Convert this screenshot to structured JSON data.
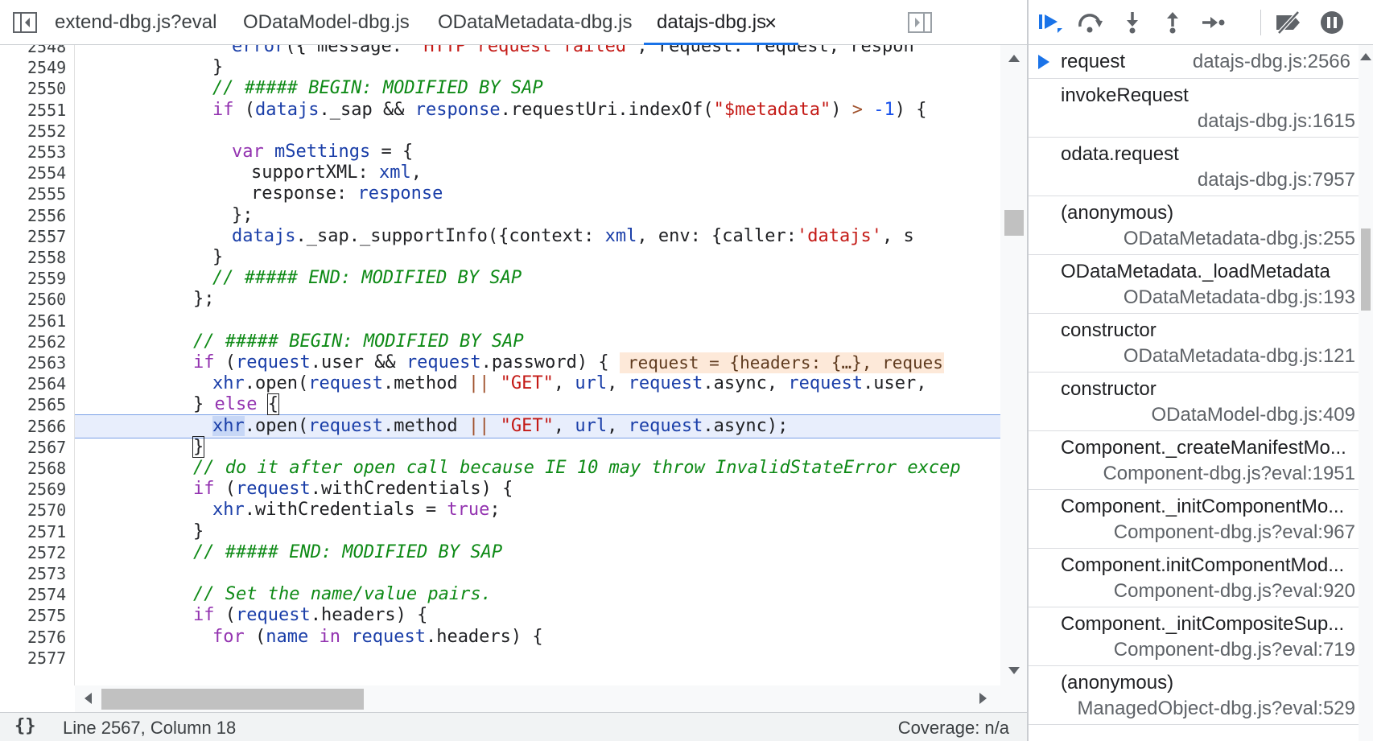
{
  "tabs": [
    {
      "label": "extend-dbg.js?eval",
      "active": false
    },
    {
      "label": "ODataModel-dbg.js",
      "active": false
    },
    {
      "label": "ODataMetadata-dbg.js",
      "active": false
    },
    {
      "label": "datajs-dbg.js",
      "active": true
    }
  ],
  "tab_close_glyph": "×",
  "editor": {
    "line_numbers": [
      "2548",
      "2549",
      "2550",
      "2551",
      "2552",
      "2553",
      "2554",
      "2555",
      "2556",
      "2557",
      "2558",
      "2559",
      "2560",
      "2561",
      "2562",
      "2563",
      "2564",
      "2565",
      "2566",
      "2567",
      "2568",
      "2569",
      "2570",
      "2571",
      "2572",
      "2573",
      "2574",
      "2575",
      "2576",
      "2577"
    ],
    "current_line": "2566",
    "inline_value": "request = {headers: {…}, requestU"
  },
  "status": {
    "pretty_print": "{}",
    "position": "Line 2567, Column 18",
    "coverage": "Coverage: n/a"
  },
  "debugger_toolbar": [
    {
      "name": "resume-icon",
      "color": "#1a73e8"
    },
    {
      "name": "step-over-icon",
      "color": "#5f6368"
    },
    {
      "name": "step-into-icon",
      "color": "#5f6368"
    },
    {
      "name": "step-out-icon",
      "color": "#5f6368"
    },
    {
      "name": "step-icon",
      "color": "#5f6368"
    },
    {
      "name": "deactivate-breakpoints-icon",
      "color": "#5f6368"
    },
    {
      "name": "pause-on-exceptions-icon",
      "color": "#5f6368"
    }
  ],
  "call_stack": [
    {
      "name": "request",
      "location": "datajs-dbg.js:2566",
      "current": true
    },
    {
      "name": "invokeRequest",
      "location": "datajs-dbg.js:1615"
    },
    {
      "name": "odata.request",
      "location": "datajs-dbg.js:7957"
    },
    {
      "name": "(anonymous)",
      "location": "ODataMetadata-dbg.js:255"
    },
    {
      "name": "ODataMetadata._loadMetadata",
      "location": "ODataMetadata-dbg.js:193"
    },
    {
      "name": "constructor",
      "location": "ODataMetadata-dbg.js:121"
    },
    {
      "name": "constructor",
      "location": "ODataModel-dbg.js:409"
    },
    {
      "name": "Component._createManifestMo...",
      "location": "Component-dbg.js?eval:1951"
    },
    {
      "name": "Component._initComponentMo...",
      "location": "Component-dbg.js?eval:967"
    },
    {
      "name": "Component.initComponentMod...",
      "location": "Component-dbg.js?eval:920"
    },
    {
      "name": "Component._initCompositeSup...",
      "location": "Component-dbg.js?eval:719"
    },
    {
      "name": "(anonymous)",
      "location": "ManagedObject-dbg.js?eval:529"
    }
  ],
  "colors": {
    "accent": "#1a73e8",
    "current_line_bg": "#e8eefc",
    "inline_value_bg": "#fde9d9",
    "comment": "#0e8a16",
    "string": "#c41a16",
    "keyword": "#9333b0"
  }
}
